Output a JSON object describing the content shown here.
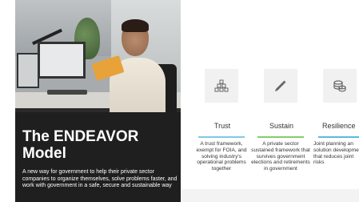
{
  "hero": {
    "title_line1": "The ENDEAVOR",
    "title_line2": "Model",
    "description": "A new way for government to help their private sector companies to organize themselves, solve problems faster, and work with government in a safe, secure and sustainable way"
  },
  "cards": [
    {
      "icon": "tiered-blocks-icon",
      "title": "Trust",
      "accent": "#7fc8e6",
      "description": "A trust framework, exempt for FOIA, and solving industry's operational problems together"
    },
    {
      "icon": "pencil-icon",
      "title": "Sustain",
      "accent": "#7fcf6a",
      "description": "A private sector sustained framework that survives government elections and retirements in government"
    },
    {
      "icon": "coins-icon",
      "title": "Resilience",
      "accent": "#5fb7e0",
      "description": "Joint planning an solution developme that reduces joint risks"
    }
  ]
}
